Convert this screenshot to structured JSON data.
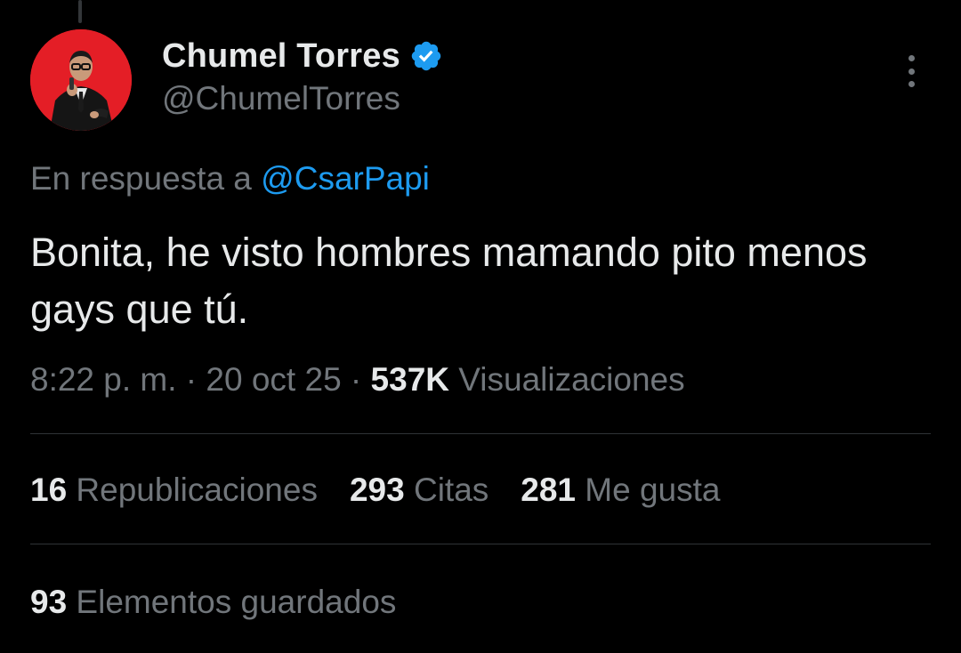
{
  "author": {
    "display_name": "Chumel Torres",
    "handle": "@ChumelTorres",
    "verified_icon": "verified-badge-icon",
    "avatar_bg": "#e41e26"
  },
  "reply": {
    "prefix": "En respuesta a ",
    "mention": "@CsarPapi"
  },
  "tweet": {
    "text": "Bonita, he visto hombres mamando pito menos gays que tú."
  },
  "meta": {
    "time": "8:22 p. m.",
    "sep1": " · ",
    "date": "20 oct 25",
    "sep2": " · ",
    "views_count": "537K",
    "views_label": " Visualizaciones"
  },
  "stats": {
    "retweets_count": "16",
    "retweets_label": " Republicaciones",
    "quotes_count": "293",
    "quotes_label": " Citas",
    "likes_count": "281",
    "likes_label": " Me gusta"
  },
  "bookmarks": {
    "count": "93",
    "label": " Elementos guardados"
  },
  "colors": {
    "background": "#000000",
    "text_primary": "#e7e9ea",
    "text_secondary": "#71767b",
    "link": "#1d9bf0",
    "divider": "#2f3336"
  }
}
